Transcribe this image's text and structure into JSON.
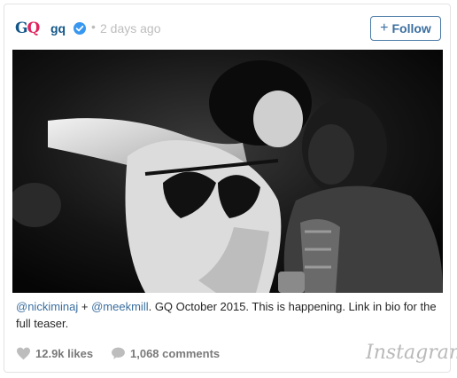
{
  "post": {
    "brand_logo": "GQ",
    "username": "gq",
    "separator": "•",
    "time": "2 days ago",
    "follow_label": "Follow",
    "follow_icon": "plus-icon"
  },
  "caption": {
    "mention1": "@nickiminaj",
    "plus": " + ",
    "mention2": "@meekmill",
    "text": ". GQ October 2015. This is happening. Link in bio for the full teaser."
  },
  "footer": {
    "likes": "12.9k likes",
    "comments": "1,068 comments",
    "brand": "Instagram"
  },
  "colors": {
    "link": "#3b6f9f",
    "muted": "#7a7a7a",
    "verified": "#3897f0"
  }
}
